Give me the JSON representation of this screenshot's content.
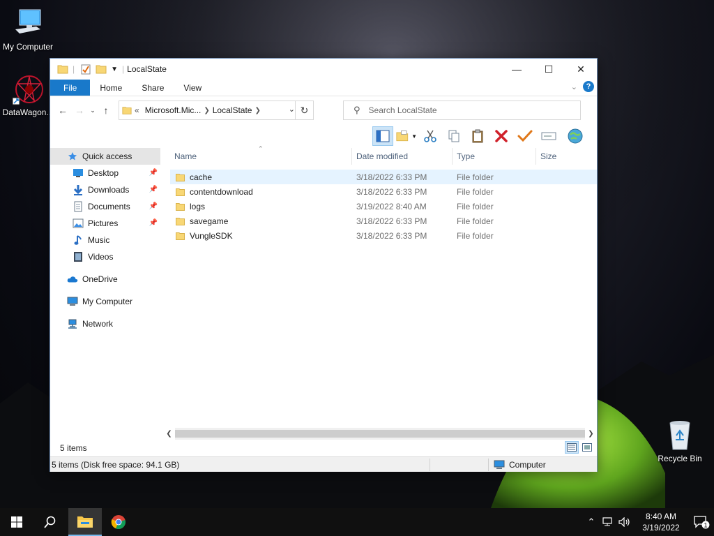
{
  "desktop": {
    "icons": [
      {
        "label": "My Computer"
      },
      {
        "label": "DataWagon..."
      },
      {
        "label": "Recycle Bin"
      }
    ]
  },
  "window": {
    "title": "LocalState",
    "ribbon_tabs": [
      "File",
      "Home",
      "Share",
      "View"
    ],
    "help_label": "?",
    "address": {
      "overflow": "«",
      "segments": [
        "Microsoft.Mic...",
        "LocalState"
      ]
    },
    "search": {
      "placeholder": "Search LocalState"
    },
    "nav": {
      "quick_access": "Quick access",
      "items": [
        {
          "label": "Desktop",
          "icon": "desktop-icon",
          "pinned": true
        },
        {
          "label": "Downloads",
          "icon": "downloads-icon",
          "pinned": true
        },
        {
          "label": "Documents",
          "icon": "documents-icon",
          "pinned": true
        },
        {
          "label": "Pictures",
          "icon": "pictures-icon",
          "pinned": true
        },
        {
          "label": "Music",
          "icon": "music-icon",
          "pinned": false
        },
        {
          "label": "Videos",
          "icon": "videos-icon",
          "pinned": false
        }
      ],
      "onedrive": "OneDrive",
      "mycomputer": "My Computer",
      "network": "Network"
    },
    "columns": {
      "name": "Name",
      "date": "Date modified",
      "type": "Type",
      "size": "Size"
    },
    "files": [
      {
        "name": "cache",
        "date": "3/18/2022 6:33 PM",
        "type": "File folder",
        "size": ""
      },
      {
        "name": "contentdownload",
        "date": "3/18/2022 6:33 PM",
        "type": "File folder",
        "size": ""
      },
      {
        "name": "logs",
        "date": "3/19/2022 8:40 AM",
        "type": "File folder",
        "size": ""
      },
      {
        "name": "savegame",
        "date": "3/18/2022 6:33 PM",
        "type": "File folder",
        "size": ""
      },
      {
        "name": "VungleSDK",
        "date": "3/18/2022 6:33 PM",
        "type": "File folder",
        "size": ""
      }
    ],
    "item_count": "5 items",
    "status_detail": "5 items (Disk free space: 94.1 GB)",
    "status_zone": "Computer"
  },
  "taskbar": {
    "clock_time": "8:40 AM",
    "clock_date": "3/19/2022",
    "notification_count": "1"
  },
  "colors": {
    "accent": "#1979ca",
    "folder": "#f8d775",
    "selection": "#cce4f7",
    "hover_row": "#e5f3ff"
  }
}
